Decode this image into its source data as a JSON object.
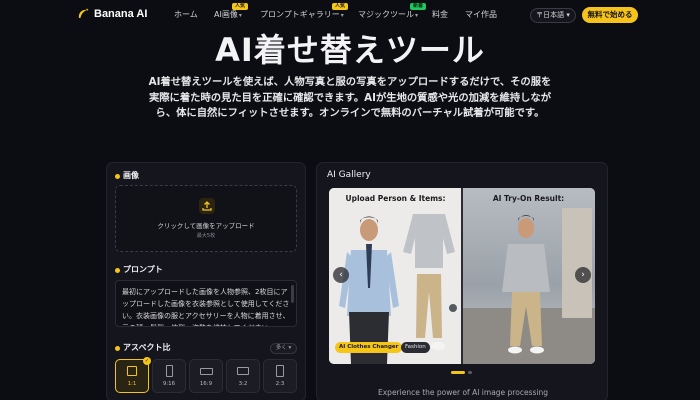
{
  "nav": {
    "logo_text": "Banana AI",
    "items": [
      {
        "label": "ホーム",
        "has_caret": false,
        "badge": ""
      },
      {
        "label": "AI画像",
        "has_caret": true,
        "badge": "人気"
      },
      {
        "label": "プロンプトギャラリー",
        "has_caret": true,
        "badge": "人気"
      },
      {
        "label": "マジックツール",
        "has_caret": true,
        "badge": "新着"
      },
      {
        "label": "料金",
        "has_caret": false,
        "badge": ""
      },
      {
        "label": "マイ作品",
        "has_caret": false,
        "badge": ""
      }
    ],
    "language": "日本語",
    "cta_label": "無料で始める"
  },
  "hero": {
    "title": "AI着せ替えツール",
    "description": "AI着せ替えツールを使えば、人物写真と服の写真をアップロードするだけで、その服を実際に着た時の見た目を正確に確認できます。AIが生地の質感や光の加減を維持しながら、体に自然にフィットさせます。オンラインで無料のバーチャル試着が可能です。"
  },
  "left_panel": {
    "image_section_label": "画像",
    "upload_text": "クリックして画像をアップロード",
    "upload_hint": "最大5枚",
    "prompt_section_label": "プロンプト",
    "prompt_text": "最初にアップロードした画像を人物参照、2枚目にアップロードした画像を衣装参照として使用してください。衣装画像の服とアクセサリーを人物に着用させ、元の顔、髪型、体型、姿勢を維持してください。",
    "aspect_section_label": "アスペクト比",
    "aspect_toggle_label": "多く ▾",
    "aspect_ratios": [
      {
        "label": "1:1",
        "selected": true
      },
      {
        "label": "9:16",
        "selected": false
      },
      {
        "label": "16:9",
        "selected": false
      },
      {
        "label": "3:2",
        "selected": false
      },
      {
        "label": "2:3",
        "selected": false
      }
    ]
  },
  "right_panel": {
    "title": "AI Gallery",
    "upload_side_title": "Upload Person & Items:",
    "result_side_title": "AI Try-On Result:",
    "tags": [
      "AI Clothes Changer",
      "Fashion"
    ],
    "caption": "Experience the power of AI image processing",
    "pagination": {
      "total": 2,
      "current": 1
    }
  },
  "colors": {
    "accent": "#f5c518",
    "background": "#0c0d12",
    "panel": "#15161d",
    "new_badge": "#22c55e"
  },
  "icons": [
    "banana-logo-icon",
    "chevron-down-icon",
    "globe-icon",
    "upload-icon",
    "chevron-left-icon",
    "chevron-right-icon",
    "check-icon"
  ]
}
